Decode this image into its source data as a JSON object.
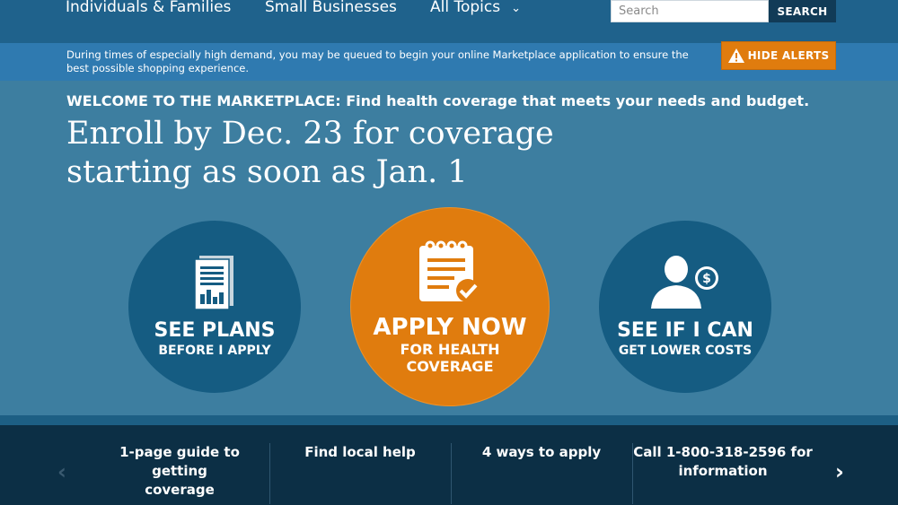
{
  "nav": {
    "items": [
      "Individuals & Families",
      "Small Businesses",
      "All Topics"
    ],
    "search_placeholder": "Search",
    "search_label": "SEARCH"
  },
  "alert": {
    "text": "During times of especially high demand, you may be queued to begin your online Marketplace application to ensure the best possible shopping experience.",
    "hide_label": "HIDE ALERTS"
  },
  "hero": {
    "welcome": "WELCOME TO THE MARKETPLACE: Find health coverage that meets your needs and budget.",
    "headline_line1": "Enroll by Dec. 23 for coverage",
    "headline_line2": "starting as soon as Jan. 1"
  },
  "circles": {
    "plans": {
      "title": "SEE PLANS",
      "subtitle": "BEFORE I APPLY"
    },
    "apply": {
      "title": "APPLY NOW",
      "subtitle1": "FOR HEALTH",
      "subtitle2": "COVERAGE"
    },
    "costs": {
      "title": "SEE IF I CAN",
      "subtitle": "GET LOWER COSTS"
    }
  },
  "bottom": {
    "items": [
      {
        "line1": "1-page guide to getting",
        "line2": "coverage"
      },
      {
        "line1": "Find local help",
        "line2": ""
      },
      {
        "line1": "4 ways to apply",
        "line2": ""
      },
      {
        "line1": "Call 1-800-318-2596 for",
        "line2": "information"
      }
    ]
  },
  "colors": {
    "nav_bg": "#1f628c",
    "hero_bg": "#3d7ea0",
    "accent_orange": "#e07c0e",
    "circle_blue": "#155c82",
    "footer_bg": "#0c2f45"
  },
  "icons": {
    "chevron": "chevron-down-icon",
    "warning": "warning-icon",
    "plans": "document-chart-icon",
    "apply": "checklist-icon",
    "costs": "person-dollar-icon",
    "prev": "chevron-left-icon",
    "next": "chevron-right-icon"
  }
}
